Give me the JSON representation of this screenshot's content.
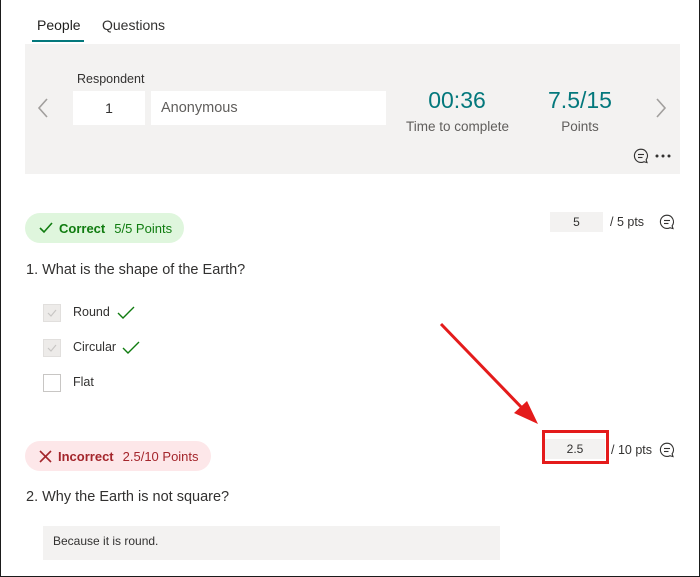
{
  "tabs": [
    {
      "label": "People",
      "active": true
    },
    {
      "label": "Questions",
      "active": false
    }
  ],
  "summary": {
    "respondent_label": "Respondent",
    "respondent_number": "1",
    "respondent_name": "Anonymous",
    "time_value": "00:36",
    "time_label": "Time to complete",
    "points_value": "7.5/15",
    "points_label": "Points"
  },
  "questions": [
    {
      "status": "Correct",
      "status_points": "5/5 Points",
      "score_value": "5",
      "score_total": "/ 5 pts",
      "text": "1. What is the shape of the Earth?",
      "options": [
        {
          "label": "Round",
          "checked": true,
          "correct": true
        },
        {
          "label": "Circular",
          "checked": true,
          "correct": true
        },
        {
          "label": "Flat",
          "checked": false,
          "correct": false
        }
      ]
    },
    {
      "status": "Incorrect",
      "status_points": "2.5/10 Points",
      "score_value": "2.5",
      "score_total": "/ 10 pts",
      "text": "2. Why the Earth is not square?",
      "answer": "Because it is round."
    }
  ],
  "colors": {
    "accent": "#03787c",
    "correct": "#107c10",
    "incorrect": "#a4262c",
    "annotation": "#e41b1b"
  },
  "icons": [
    "chevron-left-icon",
    "chevron-right-icon",
    "comment-icon",
    "more-icon",
    "checkmark-icon",
    "close-icon"
  ]
}
